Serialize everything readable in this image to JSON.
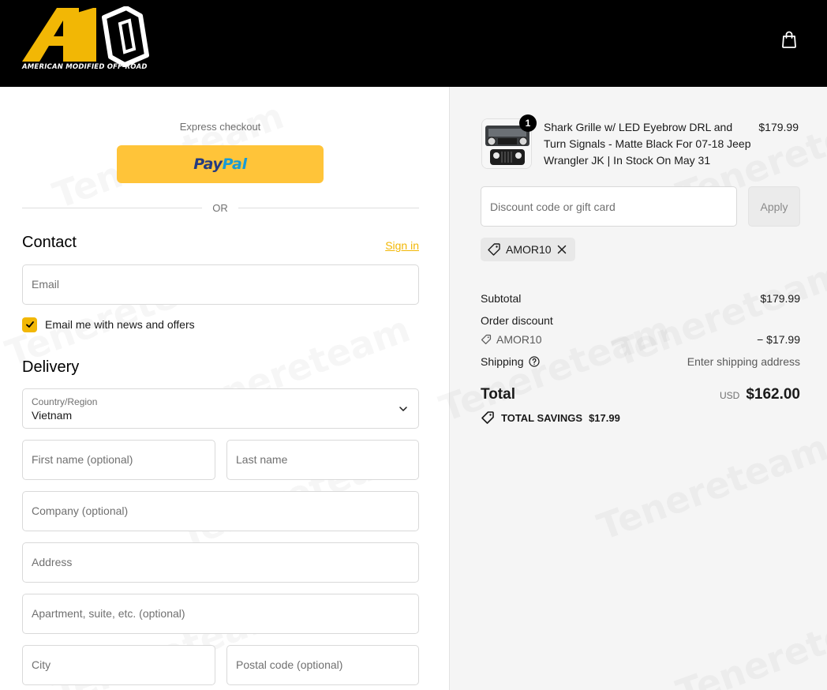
{
  "brand": {
    "name": "AMERICAN MODIFIED OFF-ROAD",
    "colors": {
      "accent": "#f2b705",
      "header_bg": "#000000",
      "paypal": "#ffc439"
    }
  },
  "header": {
    "cart_icon": "shopping-bag-icon"
  },
  "express": {
    "label": "Express checkout",
    "paypal_pay": "Pay",
    "paypal_pal": "Pal",
    "or_label": "OR"
  },
  "contact": {
    "title": "Contact",
    "signin_label": "Sign in",
    "email_placeholder": "Email",
    "newsletter_label": "Email me with news and offers",
    "newsletter_checked": true
  },
  "delivery": {
    "title": "Delivery",
    "country_label": "Country/Region",
    "country_value": "Vietnam",
    "first_name_placeholder": "First name (optional)",
    "last_name_placeholder": "Last name",
    "company_placeholder": "Company (optional)",
    "address_placeholder": "Address",
    "apartment_placeholder": "Apartment, suite, etc. (optional)",
    "city_placeholder": "City",
    "postal_placeholder": "Postal code (optional)"
  },
  "cart": {
    "items": [
      {
        "title": "Shark Grille w/ LED Eyebrow DRL and Turn Signals - Matte Black For 07-18 Jeep Wrangler JK | In Stock On May 31",
        "price": "$179.99",
        "quantity": "1"
      }
    ],
    "discount_placeholder": "Discount code or gift card",
    "apply_label": "Apply",
    "applied_code": "AMOR10"
  },
  "summary": {
    "subtotal_label": "Subtotal",
    "subtotal_value": "$179.99",
    "order_discount_label": "Order discount",
    "discount_code": "AMOR10",
    "discount_value": "− $17.99",
    "shipping_label": "Shipping",
    "shipping_value": "Enter shipping address",
    "total_label": "Total",
    "currency": "USD",
    "total_value": "$162.00",
    "savings_label": "TOTAL SAVINGS",
    "savings_value": "$17.99"
  },
  "watermark": "Tenereteam"
}
